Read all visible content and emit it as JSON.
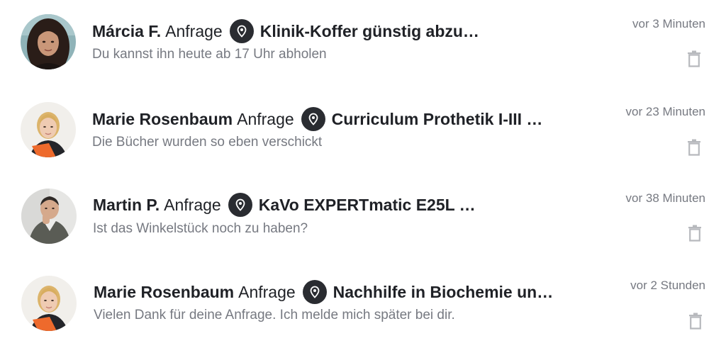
{
  "conversations": [
    {
      "name": "Márcia F.",
      "verb": "Anfrage",
      "title": "Klinik-Koffer günstig abzu…",
      "preview": "Du kannst ihn heute ab 17 Uhr abholen",
      "time": "vor 3 Minuten",
      "avatar": "woman-dark-hair-photo"
    },
    {
      "name": "Marie Rosenbaum",
      "verb": "Anfrage",
      "title": "Curriculum Prothetik I-III …",
      "preview": "Die Bücher wurden so eben verschickt",
      "time": "vor 23 Minuten",
      "avatar": "woman-blonde-orange-folder-photo"
    },
    {
      "name": "Martin P.",
      "verb": "Anfrage",
      "title": "KaVo EXPERTmatic E25L …",
      "preview": "Ist das Winkelstück noch zu haben?",
      "time": "vor 38 Minuten",
      "avatar": "man-dark-hair-photo"
    },
    {
      "name": "Marie Rosenbaum",
      "verb": "Anfrage",
      "title": "Nachhilfe in Biochemie un…",
      "preview": "Vielen Dank für deine Anfrage. Ich melde mich später bei dir.",
      "time": "vor 2 Stunden",
      "avatar": "woman-blonde-orange-folder-photo"
    }
  ],
  "icons": {
    "location": "location-pin-icon",
    "delete": "trash-icon"
  },
  "colors": {
    "text_primary": "#1f2126",
    "text_secondary": "#767981",
    "pin_badge": "#2a2c31",
    "trash": "#b7b9bd",
    "accent_orange": "#ee6a2c"
  }
}
